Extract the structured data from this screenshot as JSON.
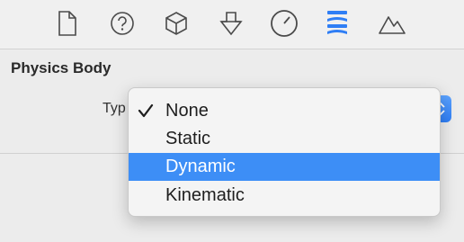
{
  "toolbar": {
    "icons": [
      "file-icon",
      "help-icon",
      "cube-icon",
      "physics-icon",
      "clock-icon",
      "layers-icon",
      "mountain-icon"
    ],
    "selected_icon": "layers-icon",
    "accent_color": "#2f7ef5"
  },
  "section": {
    "title": "Physics Body"
  },
  "type_field": {
    "label": "Typ",
    "selected_value": "None"
  },
  "menu": {
    "items": [
      {
        "label": "None",
        "checked": true,
        "highlighted": false
      },
      {
        "label": "Static",
        "checked": false,
        "highlighted": false
      },
      {
        "label": "Dynamic",
        "checked": false,
        "highlighted": true
      },
      {
        "label": "Kinematic",
        "checked": false,
        "highlighted": false
      }
    ],
    "highlight_color": "#3d8ef6"
  }
}
